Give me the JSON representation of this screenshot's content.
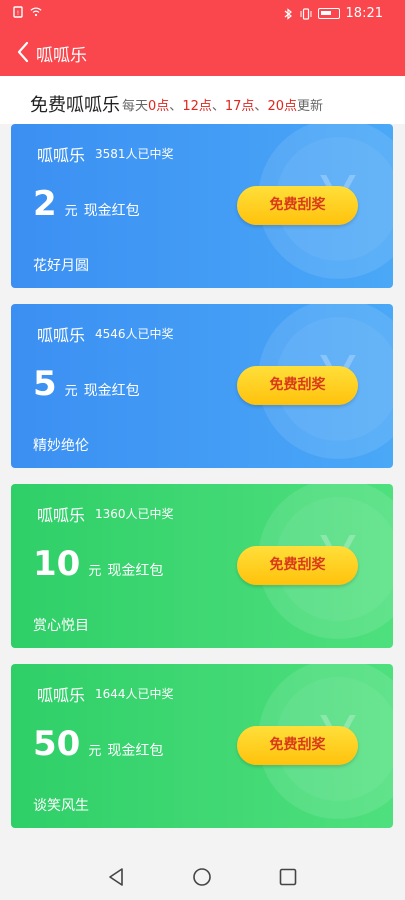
{
  "statusbar": {
    "time": "18:21"
  },
  "appbar": {
    "title": "呱呱乐"
  },
  "header": {
    "title": "免费呱呱乐",
    "sub_prefix": "每天",
    "times": [
      "0点",
      "12点",
      "17点",
      "20点"
    ],
    "separator": "、",
    "sub_suffix": "更新"
  },
  "cards": [
    {
      "title": "呱呱乐",
      "winners": "3581人已中奖",
      "amount": "2",
      "unit": "元",
      "desc": "现金红包",
      "slogan": "花好月圆",
      "button": "免费刮奖",
      "theme": "blue"
    },
    {
      "title": "呱呱乐",
      "winners": "4546人已中奖",
      "amount": "5",
      "unit": "元",
      "desc": "现金红包",
      "slogan": "精妙绝伦",
      "button": "免费刮奖",
      "theme": "blue"
    },
    {
      "title": "呱呱乐",
      "winners": "1360人已中奖",
      "amount": "10",
      "unit": "元",
      "desc": "现金红包",
      "slogan": "赏心悦目",
      "button": "免费刮奖",
      "theme": "green"
    },
    {
      "title": "呱呱乐",
      "winners": "1644人已中奖",
      "amount": "50",
      "unit": "元",
      "desc": "现金红包",
      "slogan": "谈笑风生",
      "button": "免费刮奖",
      "theme": "green"
    }
  ],
  "colors": {
    "appbar": "#f9474d",
    "highlight": "#e0261f",
    "blue": "#3b8ff2",
    "green": "#2fcf68",
    "button": "#ffc20c"
  }
}
